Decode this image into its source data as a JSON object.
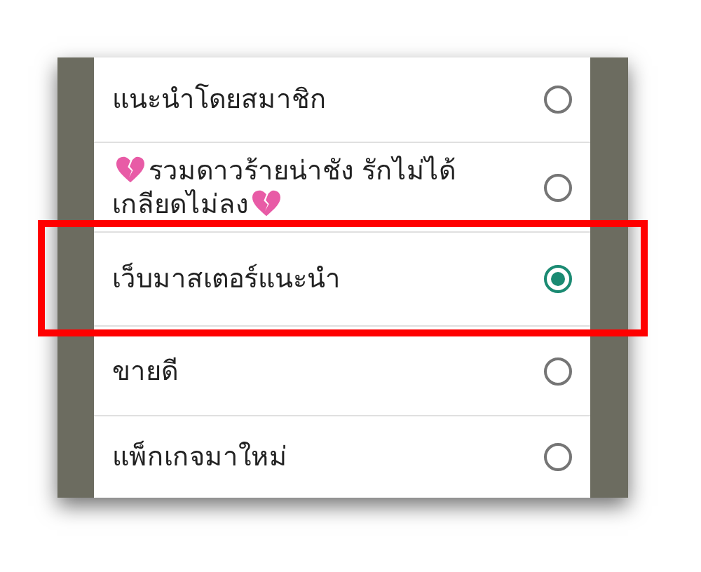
{
  "options": [
    {
      "label": "แนะนำโดยสมาชิก",
      "selected": false,
      "highlighted": false
    },
    {
      "lines": [
        "รวมดาวร้ายน่าชัง รักไม่ได้",
        "เกลียดไม่ลง"
      ],
      "kind": "hearts",
      "selected": false,
      "highlighted": false
    },
    {
      "label": "เว็บมาสเตอร์แนะนำ",
      "selected": true,
      "highlighted": true
    },
    {
      "label": "ขายดี",
      "selected": false,
      "highlighted": false
    },
    {
      "label": "แพ็กเกจมาใหม่",
      "selected": false,
      "highlighted": false
    }
  ]
}
